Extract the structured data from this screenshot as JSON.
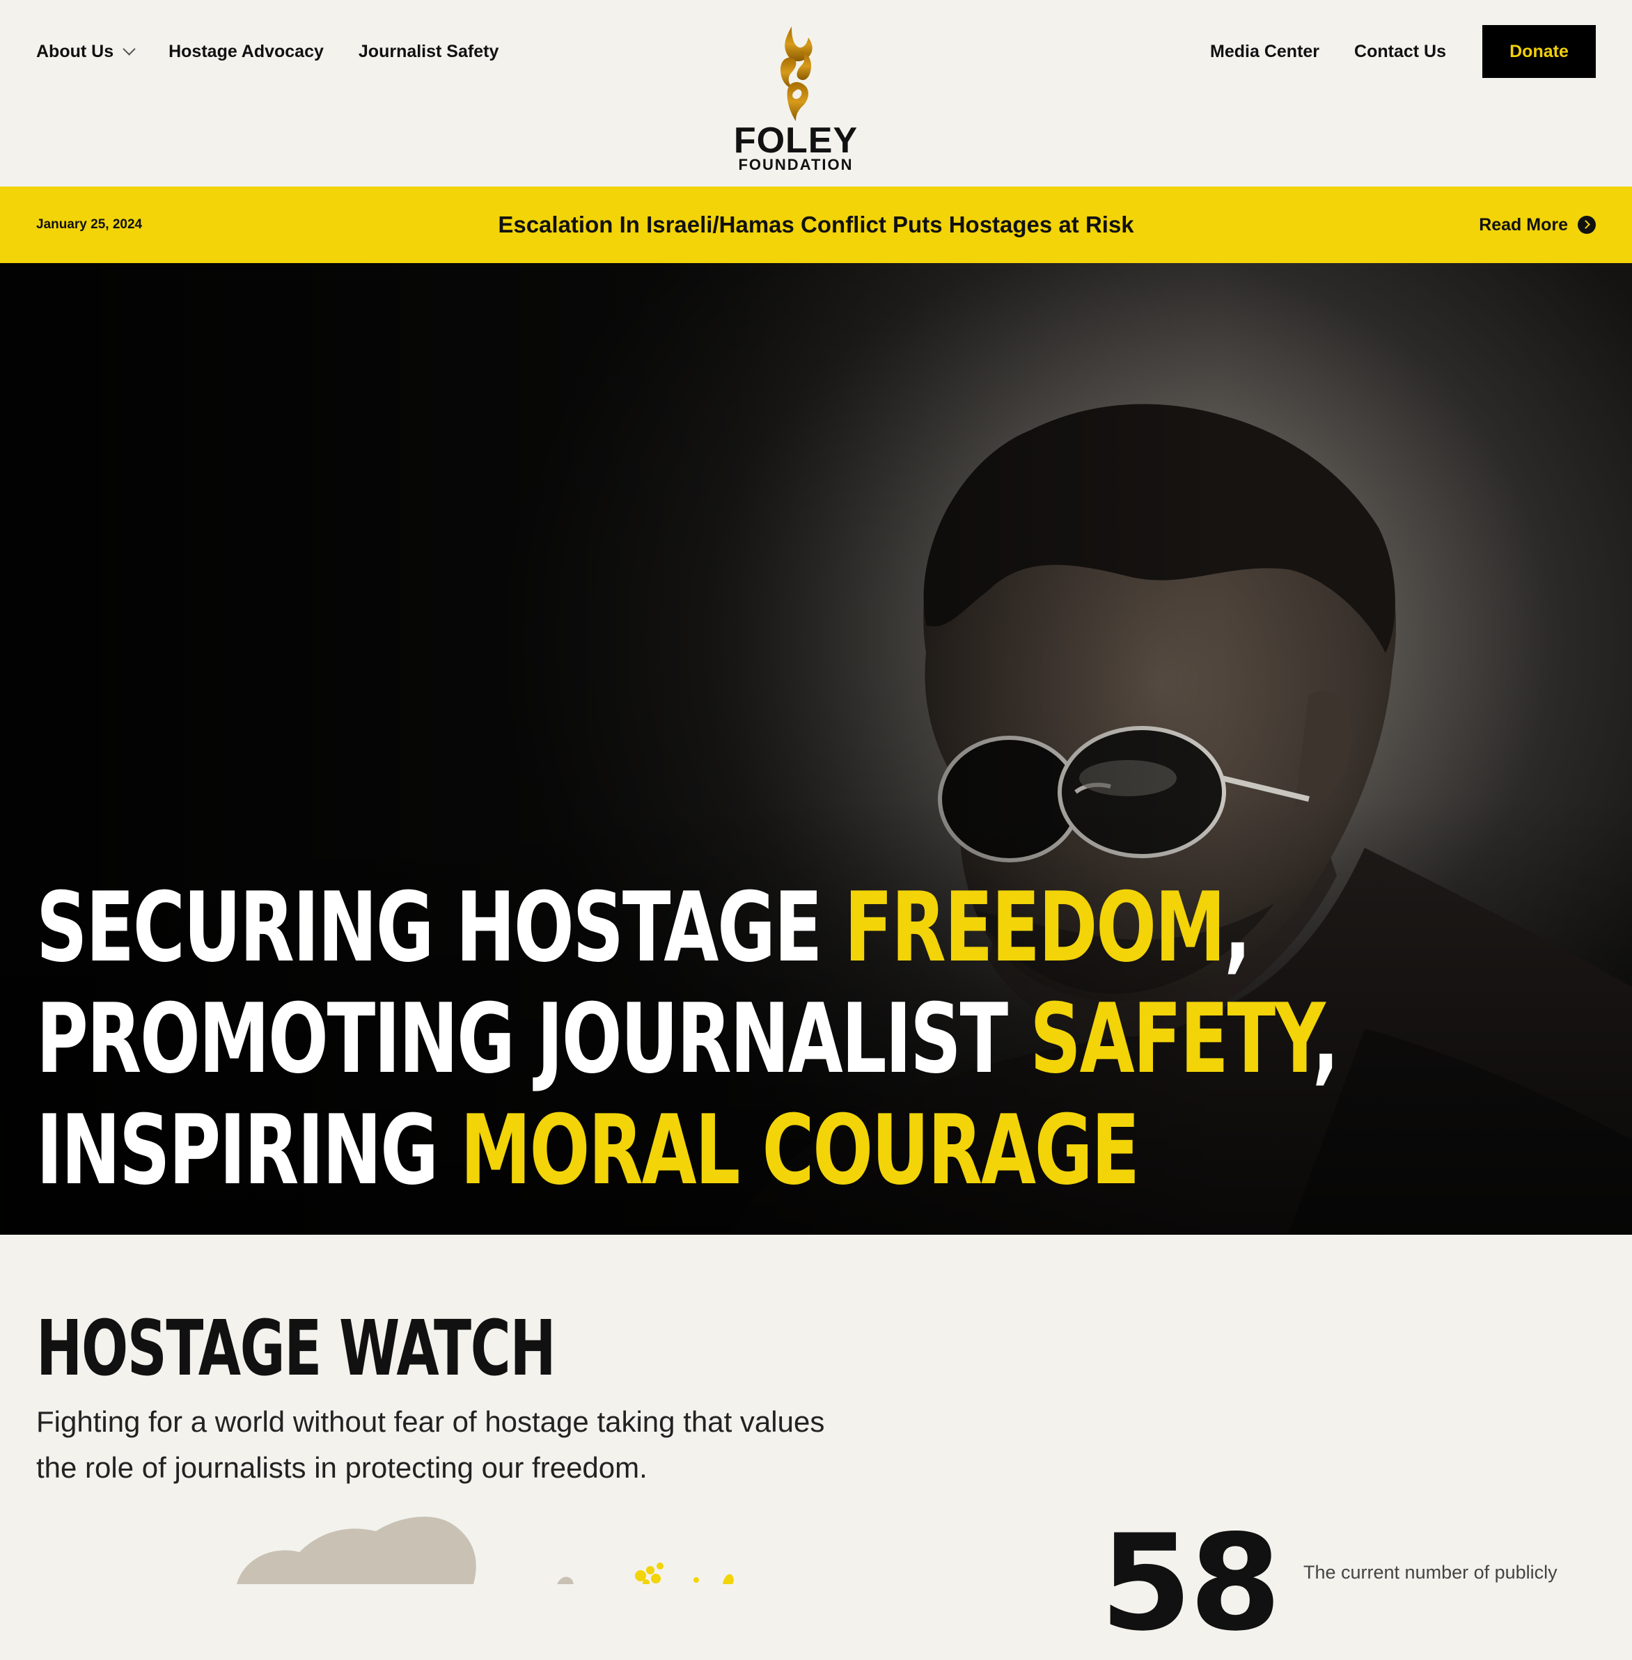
{
  "header": {
    "nav_left": [
      {
        "label": "About Us",
        "has_dropdown": true
      },
      {
        "label": "Hostage Advocacy"
      },
      {
        "label": "Journalist Safety"
      }
    ],
    "nav_right": [
      {
        "label": "Media Center"
      },
      {
        "label": "Contact Us"
      }
    ],
    "donate_label": "Donate",
    "logo": {
      "line1": "FOLEY",
      "line2": "FOUNDATION"
    }
  },
  "alert": {
    "date": "January 25, 2024",
    "headline": "Escalation In Israeli/Hamas Conflict Puts Hostages at Risk",
    "read_more": "Read More",
    "icon": "arrow-right-circle-icon"
  },
  "hero": {
    "line1_a": "SECURING HOSTAGE ",
    "line1_b": "FREEDOM",
    "line1_c": ",",
    "line2_a": "PROMOTING JOURNALIST ",
    "line2_b": "SAFETY",
    "line2_c": ",",
    "line3_a": "INSPIRING ",
    "line3_b": "MORAL COURAGE"
  },
  "hostage_watch": {
    "title": "HOSTAGE WATCH",
    "subtitle_line1": "Fighting for a world without fear of hostage taking that values",
    "subtitle_line2": "the role of journalists in protecting our freedom.",
    "count": "58",
    "count_description": "The current number of publicly"
  },
  "colors": {
    "accent_yellow": "#f2d408",
    "background": "#f3f2ed",
    "dark": "#000000",
    "logo_gold": "#b8860b"
  }
}
